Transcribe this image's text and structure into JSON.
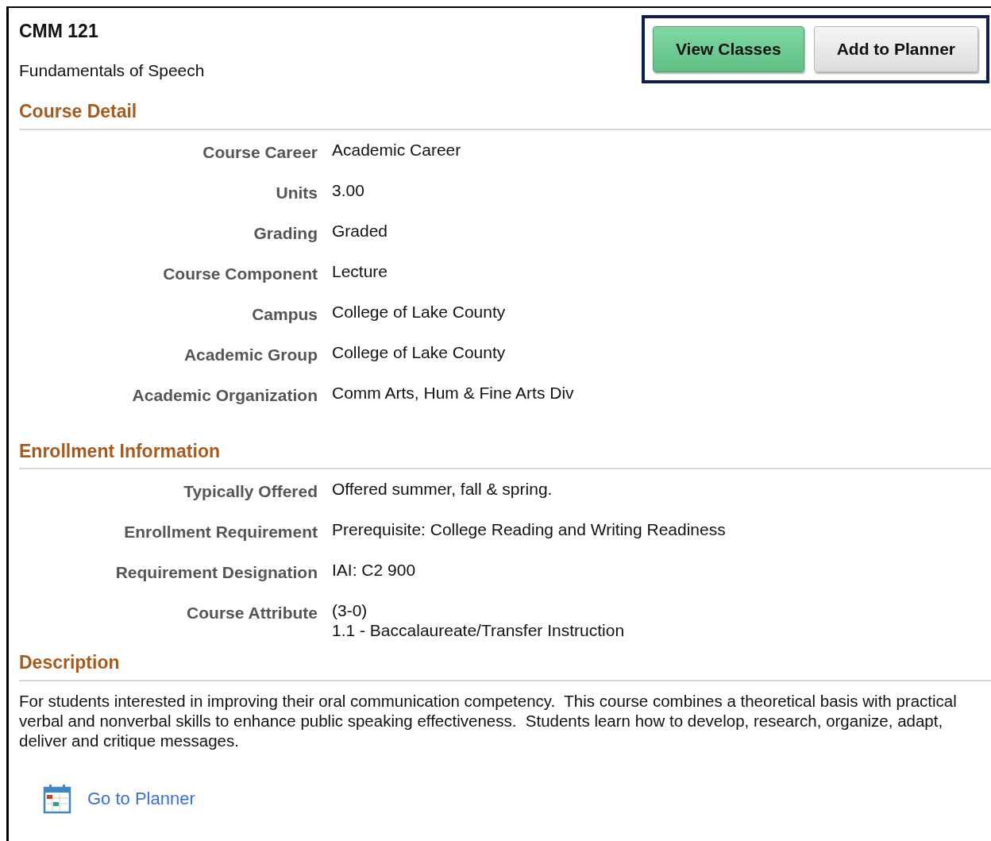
{
  "course": {
    "code": "CMM 121",
    "title": "Fundamentals of Speech"
  },
  "buttons": [
    {
      "label": "View Classes",
      "kind": "primary"
    },
    {
      "label": "Add to Planner",
      "kind": "secondary"
    }
  ],
  "sections": [
    {
      "heading": "Course Detail",
      "fields": [
        {
          "label": "Course Career",
          "value": [
            "Academic Career"
          ]
        },
        {
          "label": "Units",
          "value": [
            "3.00"
          ]
        },
        {
          "label": "Grading",
          "value": [
            "Graded"
          ]
        },
        {
          "label": "Course Component",
          "value": [
            "Lecture"
          ]
        },
        {
          "label": "Campus",
          "value": [
            "College of Lake County"
          ]
        },
        {
          "label": "Academic Group",
          "value": [
            "College of Lake County"
          ]
        },
        {
          "label": "Academic Organization",
          "value": [
            "Comm Arts, Hum & Fine Arts Div"
          ]
        }
      ]
    },
    {
      "heading": "Enrollment Information",
      "fields": [
        {
          "label": "Typically Offered",
          "value": [
            "Offered summer, fall & spring."
          ]
        },
        {
          "label": "Enrollment Requirement",
          "value": [
            "Prerequisite: College Reading and Writing Readiness"
          ]
        },
        {
          "label": "Requirement Designation",
          "value": [
            "IAI: C2 900"
          ]
        },
        {
          "label": "Course Attribute",
          "value": [
            "(3-0)",
            "1.1 - Baccalaureate/Transfer Instruction"
          ]
        }
      ]
    }
  ],
  "description": {
    "heading": "Description",
    "text": "For students interested in improving their oral communication competency.  This course combines a theoretical basis with practical verbal and nonverbal skills to enhance public speaking effectiveness.  Students learn how to develop, research, organize, adapt, deliver and critique messages."
  },
  "planner_link": "Go to Planner"
}
